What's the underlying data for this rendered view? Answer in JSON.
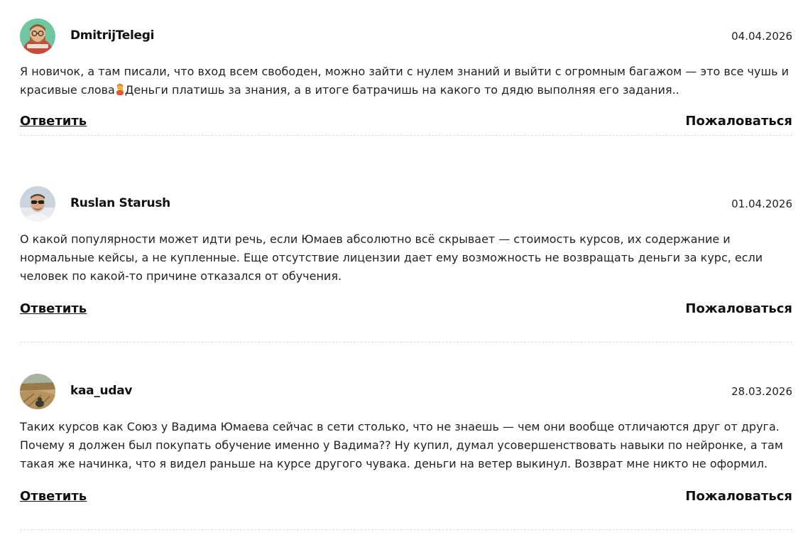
{
  "comments": [
    {
      "author": "DmitrijTelegi",
      "date": "04.04.2026",
      "avatar": "avatar-cartoon-man-with-beard",
      "text_before_emoji": "Я новичок, а там писали, что вход всем свободен, можно зайти с нулем знаний и выйти с огромным багажом — это все чушь и красивые слова",
      "emoji": "person-facepalming-icon",
      "text_after_emoji": "Деньги платишь за знания, а в итоге батрачишь на какого то дядю выполняя его задания..",
      "reply_label": "Ответить",
      "complain_label": "Пожаловаться"
    },
    {
      "author": "Ruslan Starush",
      "date": "01.04.2026",
      "avatar": "avatar-photo-man-with-sunglasses",
      "text": "О какой популярности может идти речь, если Юмаев абсолютно всё скрывает — стоимость курсов, их содержание и нормальные кейсы, а не купленные. Еще отсутствие лицензии дает ему возможность не возвращать деньги за курс, если человек по какой-то причине отказался от обучения.",
      "reply_label": "Ответить",
      "complain_label": "Пожаловаться"
    },
    {
      "author": "kaa_udav",
      "date": "28.03.2026",
      "avatar": "avatar-photo-dry-field",
      "text": "Таких курсов как Союз у Вадима Юмаева сейчас в сети столько, что не знаешь — чем они вообще отличаются друг от друга. Почему я должен был покупать обучение именно у Вадима?? Ну купил, думал усовершенствовать навыки по нейронке, а там такая же начинка, что я видел раньше на курсе другого чувака. деньги на ветер выкинул. Возврат мне никто не оформил.",
      "reply_label": "Ответить",
      "complain_label": "Пожаловаться"
    }
  ]
}
